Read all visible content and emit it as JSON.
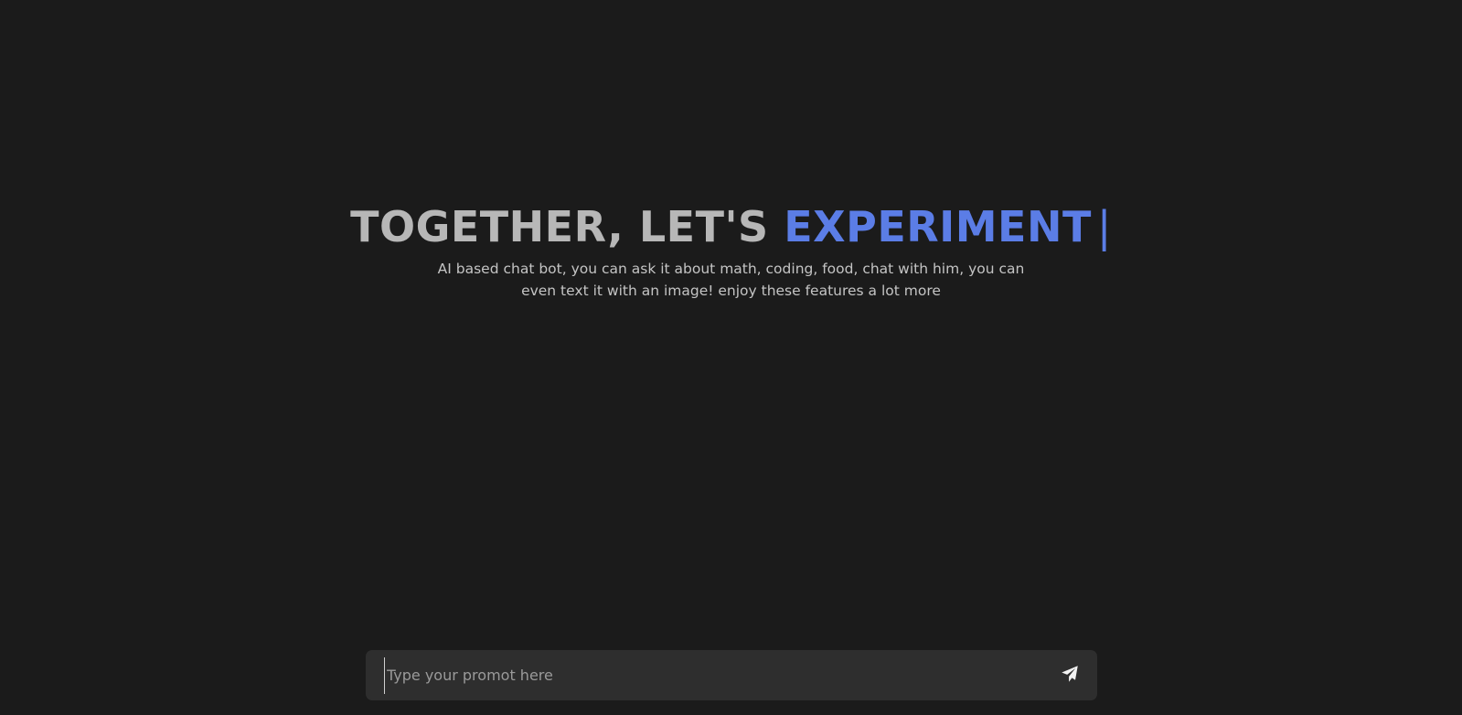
{
  "hero": {
    "headline_lead": "TOGETHER, LET'S ",
    "headline_accent": "EXPERIMENT",
    "headline_cursor": "|",
    "subtitle": "AI based chat bot, you can ask it about math, coding, food, chat with him, you can even text it with an image! enjoy these features a lot more"
  },
  "composer": {
    "placeholder": "Type your promot here",
    "value": "",
    "send_icon": "paper-plane-icon"
  },
  "colors": {
    "background": "#1b1b1b",
    "accent": "#5b7de6",
    "headline_gray": "#b7b7b7",
    "input_bg": "#2e2e2e"
  }
}
